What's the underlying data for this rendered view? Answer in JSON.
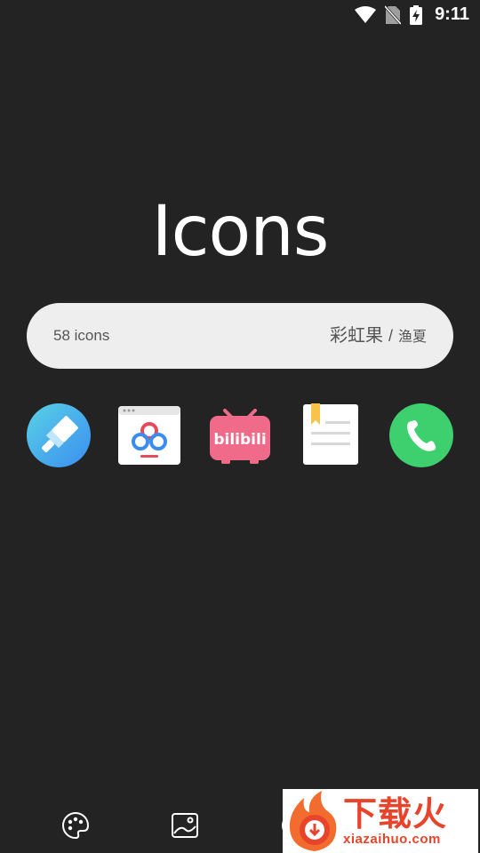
{
  "status_bar": {
    "time": "9:11",
    "icons": [
      "wifi-icon",
      "no-sim-icon",
      "battery-charging-icon"
    ]
  },
  "title": "Icons",
  "info": {
    "count": "58 icons",
    "credit_primary": "彩虹果",
    "separator": "/",
    "credit_secondary": "渔夏"
  },
  "preview_icons": [
    "eraser-app-icon",
    "baidu-netdisk-icon",
    "bilibili-icon",
    "notes-app-icon",
    "phone-app-icon"
  ],
  "bilibili_label": "bilibili",
  "bottom_nav": [
    "palette-icon",
    "wallpaper-icon"
  ],
  "watermark": {
    "main": "下载火",
    "sub": "xiazaihuo.com"
  },
  "colors": {
    "background": "#232323",
    "pill": "#eeeeee",
    "phone_green": "#3ecf6e",
    "bilibili_pink": "#f06a8a",
    "eraser_blue": "#4aa8f0",
    "watermark_red": "#e8432b"
  }
}
